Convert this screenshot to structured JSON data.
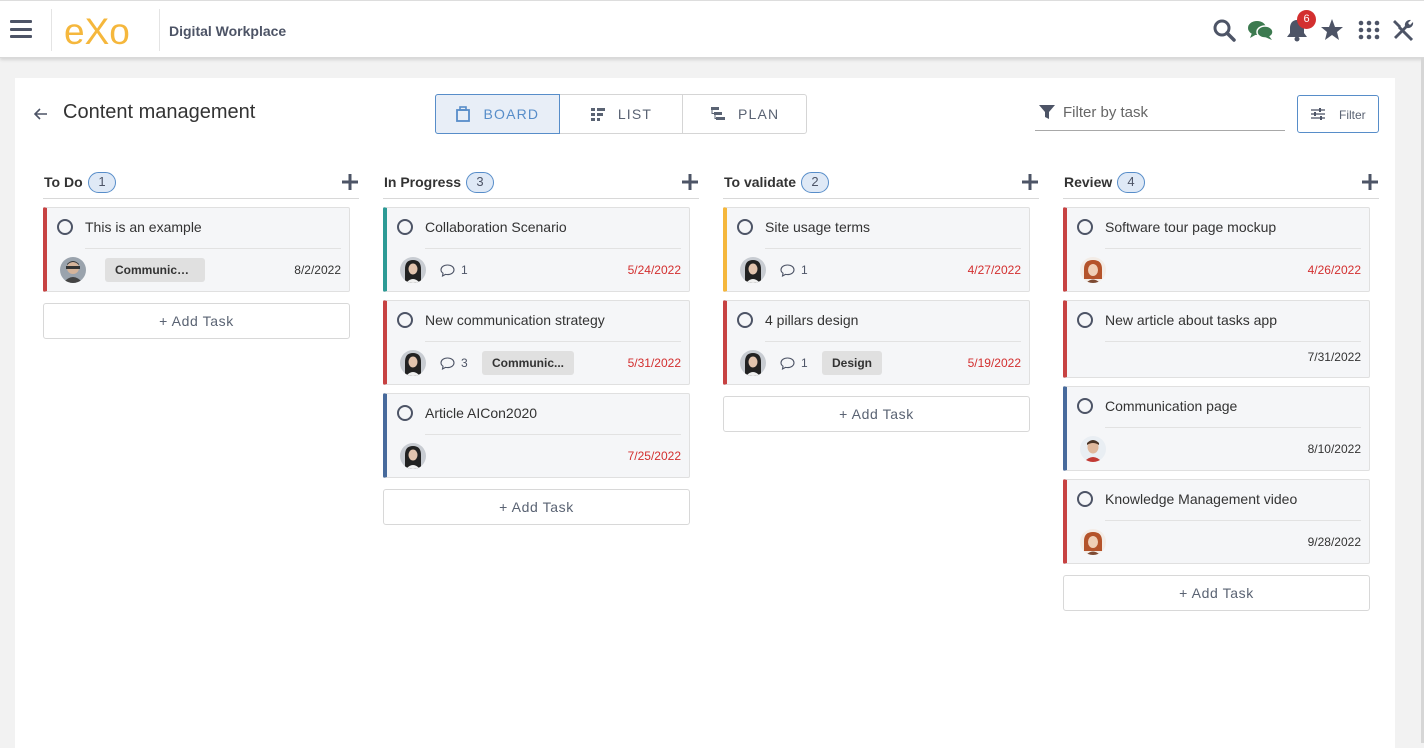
{
  "app": {
    "brand": "Digital Workplace",
    "logo_text": "eXo",
    "notification_count": "6"
  },
  "page": {
    "title": "Content management"
  },
  "views": [
    {
      "label": "BOARD"
    },
    {
      "label": "LIST"
    },
    {
      "label": "PLAN"
    }
  ],
  "filter": {
    "placeholder": "Filter by task",
    "button_label": "Filter"
  },
  "add_task_label": "+ Add Task",
  "columns": [
    {
      "name": "To Do",
      "count": "1",
      "tasks": [
        {
          "title": "This is an example",
          "label": "Communication",
          "date": "8/2/2022",
          "overdue": false,
          "priority_color": "#c74242",
          "avatar": "man-glasses"
        }
      ]
    },
    {
      "name": "In Progress",
      "count": "3",
      "tasks": [
        {
          "title": "Collaboration Scenario",
          "comments": "1",
          "date": "5/24/2022",
          "overdue": true,
          "priority_color": "#2c9a95",
          "avatar": "woman-dark"
        },
        {
          "title": "New communication strategy",
          "comments": "3",
          "label": "Communic...",
          "date": "5/31/2022",
          "overdue": true,
          "priority_color": "#c74242",
          "avatar": "woman-dark"
        },
        {
          "title": "Article AICon2020",
          "date": "7/25/2022",
          "overdue": true,
          "priority_color": "#476a9c",
          "avatar": "woman-dark"
        }
      ]
    },
    {
      "name": "To validate",
      "count": "2",
      "tasks": [
        {
          "title": "Site usage terms",
          "comments": "1",
          "date": "4/27/2022",
          "overdue": true,
          "priority_color": "#f5b73c",
          "avatar": "woman-dark"
        },
        {
          "title": "4 pillars design",
          "comments": "1",
          "label": "Design",
          "date": "5/19/2022",
          "overdue": true,
          "priority_color": "#c74242",
          "avatar": "woman-dark"
        }
      ]
    },
    {
      "name": "Review",
      "count": "4",
      "tasks": [
        {
          "title": "Software tour page mockup",
          "date": "4/26/2022",
          "overdue": true,
          "priority_color": "#c74242",
          "avatar": "woman-red"
        },
        {
          "title": "New article about tasks app",
          "date": "7/31/2022",
          "overdue": false,
          "priority_color": "#c74242"
        },
        {
          "title": "Communication page",
          "date": "8/10/2022",
          "overdue": false,
          "priority_color": "#476a9c",
          "avatar": "man-shirt"
        },
        {
          "title": "Knowledge Management video",
          "date": "9/28/2022",
          "overdue": false,
          "priority_color": "#c74242",
          "avatar": "woman-red"
        }
      ]
    }
  ],
  "colors": {
    "accent": "#578dc9",
    "icon": "#4d5466",
    "late": "#d32f2f",
    "logo": "#f5b73c",
    "chat": "#3c7a4f"
  }
}
